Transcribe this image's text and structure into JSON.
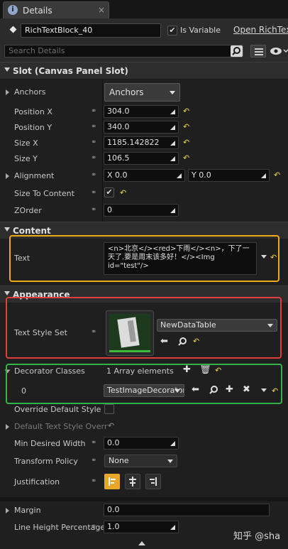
{
  "tab": {
    "label": "Details",
    "info_glyph": "i",
    "close_glyph": "×"
  },
  "header": {
    "widget_name": "RichTextBlock_40",
    "is_variable_label": "Is Variable",
    "is_variable_checked": true,
    "open_link": "Open RichTex",
    "search_placeholder": "Search Details"
  },
  "slot": {
    "category": "Slot (Canvas Panel Slot)",
    "anchors_label": "Anchors",
    "anchors_value": "Anchors",
    "position_x_label": "Position X",
    "position_x": "304.0",
    "position_y_label": "Position Y",
    "position_y": "340.0",
    "size_x_label": "Size X",
    "size_x": "1185.142822",
    "size_y_label": "Size Y",
    "size_y": "106.5",
    "alignment_label": "Alignment",
    "align_x": "X  0.0",
    "align_y": "Y  0.0",
    "size_to_content_label": "Size To Content",
    "size_to_content_checked": true,
    "zorder_label": "ZOrder",
    "zorder": "0"
  },
  "content": {
    "category": "Content",
    "text_label": "Text",
    "text_value": "<n>北京</><red>下雨</><n>，下了一天了.要是周末该多好！</><Img id=\"test\"/>"
  },
  "appearance": {
    "category": "Appearance",
    "text_style_set_label": "Text Style Set",
    "text_style_set_value": "NewDataTable",
    "decorator_label": "Decorator Classes",
    "decorator_count": "1 Array elements",
    "decorator_index": "0",
    "decorator_value": "TestImageDecorator",
    "override_label": "Override Default Style",
    "default_text_style_label": "Default Text Style Overr",
    "min_width_label": "Min Desired Width",
    "min_width": "0.0",
    "transform_label": "Transform Policy",
    "transform_value": "None",
    "justification_label": "Justification",
    "margin_label": "Margin",
    "margin_value": "0.0",
    "line_height_label": "Line Height Percentage",
    "line_height": "1.0"
  },
  "watermark": "知乎 @sha",
  "colors": {
    "yellow": "#f0a91a",
    "red": "#e23d3d",
    "green": "#33b34a",
    "reset": "#e8d83a"
  }
}
